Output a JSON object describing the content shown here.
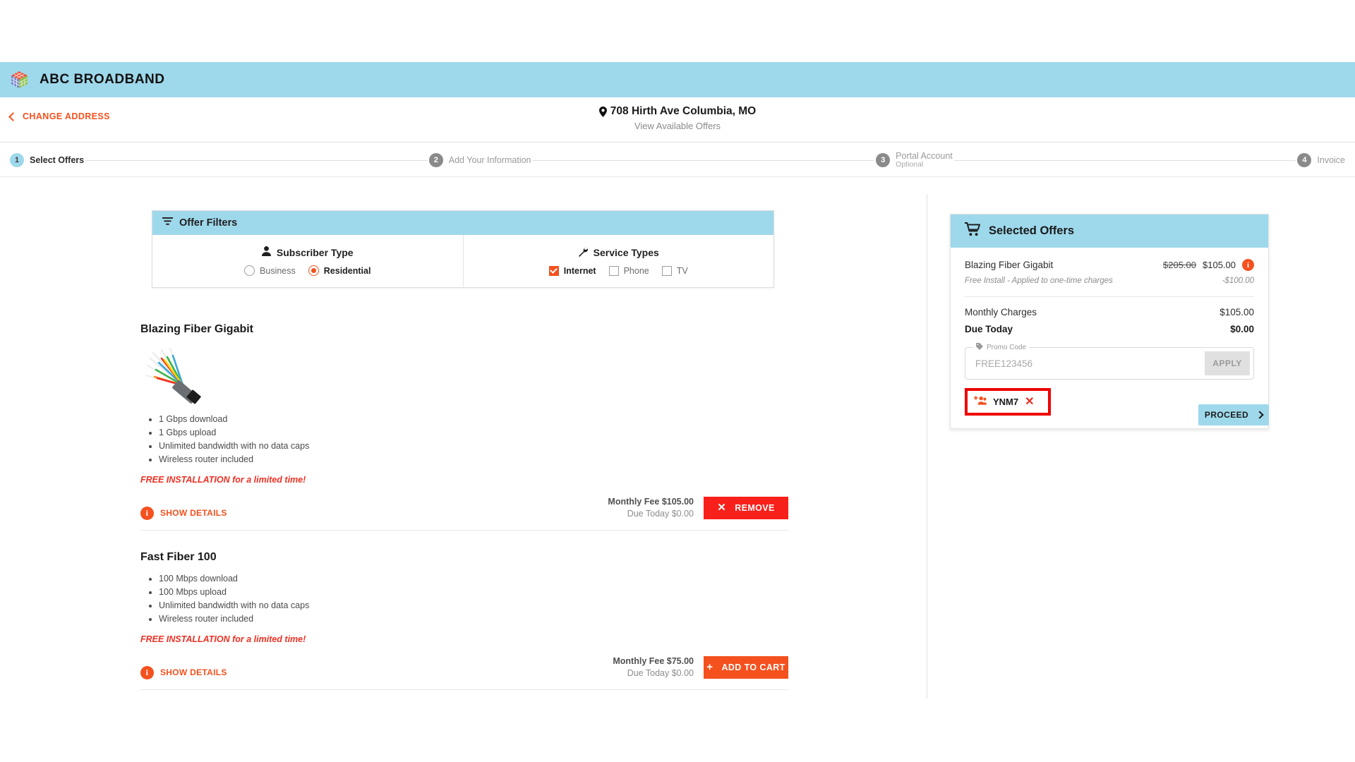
{
  "brand": {
    "logo_icon": "cube-logo-icon",
    "name": "ABC BROADBAND"
  },
  "address_bar": {
    "change_address_label": "CHANGE ADDRESS",
    "back_icon": "chevron-left-icon",
    "pin_icon": "map-pin-icon",
    "address": "708 Hirth Ave Columbia, MO",
    "subtitle": "View Available Offers"
  },
  "stepper": {
    "steps": [
      {
        "num": "1",
        "label": "Select Offers",
        "sub": "",
        "active": true
      },
      {
        "num": "2",
        "label": "Add Your Information",
        "sub": "",
        "active": false
      },
      {
        "num": "3",
        "label": "Portal Account",
        "sub": "Optional",
        "active": false
      },
      {
        "num": "4",
        "label": "Invoice",
        "sub": "",
        "active": false
      }
    ]
  },
  "filters": {
    "header_icon": "filter-icon",
    "header_title": "Offer Filters",
    "subscriber": {
      "icon": "person-icon",
      "title": "Subscriber Type",
      "options": [
        {
          "label": "Business",
          "selected": false
        },
        {
          "label": "Residential",
          "selected": true
        }
      ]
    },
    "service": {
      "icon": "wrench-icon",
      "title": "Service Types",
      "options": [
        {
          "label": "Internet",
          "checked": true
        },
        {
          "label": "Phone",
          "checked": false
        },
        {
          "label": "TV",
          "checked": false
        }
      ]
    }
  },
  "offers": [
    {
      "title": "Blazing Fiber Gigabit",
      "image_icon": "fiber-optic-cable-image",
      "features": [
        "1 Gbps download",
        "1 Gbps upload",
        "Unlimited bandwidth with no data caps",
        "Wireless router included"
      ],
      "promo_text": "FREE INSTALLATION for a limited time!",
      "show_details_label": "SHOW DETAILS",
      "monthly_fee": "Monthly Fee $105.00",
      "due_today": "Due Today $0.00",
      "action_label": "REMOVE",
      "action_glyph": "✕",
      "action_kind": "remove"
    },
    {
      "title": "Fast Fiber 100",
      "image_icon": "",
      "features": [
        "100 Mbps download",
        "100 Mbps upload",
        "Unlimited bandwidth with no data caps",
        "Wireless router included"
      ],
      "promo_text": "FREE INSTALLATION for a limited time!",
      "show_details_label": "SHOW DETAILS",
      "monthly_fee": "Monthly Fee $75.00",
      "due_today": "Due Today $0.00",
      "action_label": "ADD TO CART",
      "action_glyph": "+",
      "action_kind": "add"
    }
  ],
  "selected_offers": {
    "header_icon": "shopping-cart-icon",
    "header_title": "Selected Offers",
    "item_name": "Blazing Fiber Gigabit",
    "item_price_original": "$205.00",
    "item_price_current": "$105.00",
    "item_info_icon": "info-icon",
    "discount_label": "Free Install - Applied to one-time charges",
    "discount_value": "-$100.00",
    "monthly_charges_label": "Monthly Charges",
    "monthly_charges_value": "$105.00",
    "due_today_label": "Due Today",
    "due_today_value": "$0.00",
    "promo": {
      "legend_icon": "tag-icon",
      "legend": "Promo Code",
      "placeholder": "FREE123456",
      "value": "",
      "apply_label": "APPLY"
    },
    "applied_chip": {
      "icon": "add-group-icon",
      "label": "YNM7",
      "remove_icon": "close-x-icon"
    },
    "proceed_label": "PROCEED",
    "proceed_icon": "chevron-right-icon"
  },
  "colors": {
    "brand_blue": "#9ED8EB",
    "accent_orange": "#F4511E",
    "danger_red": "#F8201B",
    "promo_red": "#EE3124",
    "highlight_red": "#EE0000"
  }
}
